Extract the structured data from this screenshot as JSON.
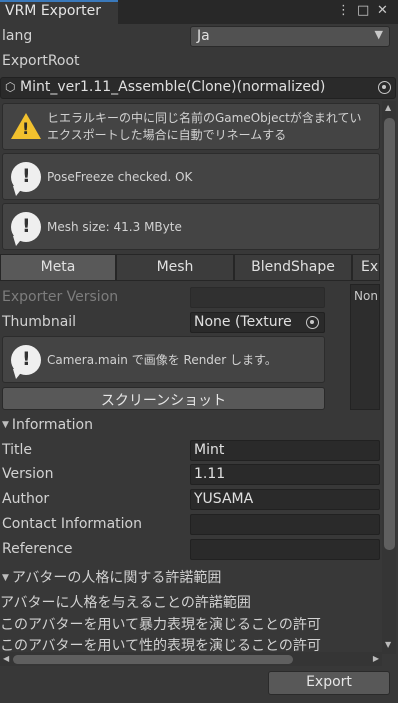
{
  "window": {
    "title": "VRM Exporter"
  },
  "lang": {
    "label": "lang",
    "value": "Ja"
  },
  "export_root": {
    "label": "ExportRoot",
    "value": "Mint_ver1.11_Assemble(Clone)(normalized)"
  },
  "messages": [
    {
      "type": "warning",
      "lines": [
        "ヒエラルキーの中に同じ名前のGameObjectが含まれてい",
        "エクスポートした場合に自動でリネームする"
      ]
    },
    {
      "type": "info",
      "lines": [
        "PoseFreeze checked. OK"
      ]
    },
    {
      "type": "info",
      "lines": [
        "Mesh size: 41.3 MByte"
      ]
    }
  ],
  "tabs": [
    "Meta",
    "Mesh",
    "BlendShape",
    "Ex"
  ],
  "meta": {
    "exporter_version_label": "Exporter Version",
    "exporter_version_value": "",
    "thumbnail_label": "Thumbnail",
    "thumbnail_value": "None (Texture",
    "side_panel_text": "Non",
    "thumbnail_help": "Camera.main で画像を Render します。",
    "screenshot_button": "スクリーンショット"
  },
  "information": {
    "header": "Information",
    "title_label": "Title",
    "title_value": "Mint",
    "version_label": "Version",
    "version_value": "1.11",
    "author_label": "Author",
    "author_value": "YUSAMA",
    "contact_label": "Contact Information",
    "contact_value": "",
    "reference_label": "Reference",
    "reference_value": ""
  },
  "permission": {
    "header": "アバターの人格に関する許諾範囲",
    "line1": "アバターに人格を与えることの許諾範囲",
    "line2": "このアバターを用いて暴力表現を演じることの許可",
    "line3": "このアバターを用いて性的表現を演じることの許可"
  },
  "export_button": "Export",
  "colors": {
    "accent": "#3a79bb",
    "warning": "#f2c12e",
    "background": "#383838"
  }
}
